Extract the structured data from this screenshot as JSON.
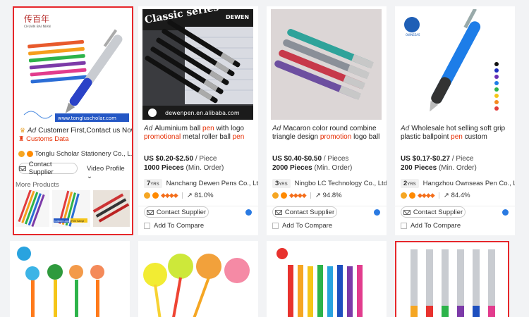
{
  "colors": {
    "accent": "#e62e04",
    "highlight": "#e6272b",
    "chat": "#2a7ae2"
  },
  "cards": [
    {
      "ad": "Ad",
      "title": "Customer First,Contact us Now!",
      "customs": "Customs Data",
      "supplier": "Tonglu Scholar Stationery Co., L...",
      "contact": "Contact Supplier",
      "video": "Video Profile",
      "more": "More Products",
      "brand": "CHUAN BAI NIAN",
      "brand_logo": "传百年",
      "url_banner": "www.tongluscholar.com",
      "thumb_text_1": "Custom Logo",
      "thumb_text_2": "Free Sampl"
    },
    {
      "ad": "Ad",
      "title_parts": [
        "Aluminium ball ",
        "pen",
        " with logo ",
        "promotional",
        " metal roller ball ",
        "pen"
      ],
      "price": "US $0.20-$2.50",
      "unit": "/ Piece",
      "moq": "1000 Pieces",
      "moq_note": "(Min. Order)",
      "years": "7",
      "yrs_label": "YRS",
      "supplier": "Nanchang Dewen Pens Co., Ltd.",
      "rate": "81.0%",
      "contact": "Contact Supplier",
      "compare": "Add To Compare",
      "banner_top": "Classic series",
      "banner_brand": "DEWEN",
      "banner_url": "dewenpen.en.alibaba.com",
      "banner_logo": "DEWEN"
    },
    {
      "ad": "Ad",
      "title_parts": [
        "Macaron color round combine triangle design ",
        "promotion",
        " logo ball ",
        "pen"
      ],
      "price": "US $0.40-$0.50",
      "unit": "/ Pieces",
      "moq": "2000 Pieces",
      "moq_note": "(Min. Order)",
      "years": "3",
      "yrs_label": "YRS",
      "supplier": "Ningbo LC Technology Co., Ltd.",
      "rate": "94.8%",
      "contact": "Contact Supplier",
      "compare": "Add To Compare"
    },
    {
      "ad": "Ad",
      "title_parts": [
        "Wholesale hot selling soft grip plastic ballpoint ",
        "pen",
        " custom company name..."
      ],
      "price": "US $0.17-$0.27",
      "unit": "/ Piece",
      "moq": "200 Pieces",
      "moq_note": "(Min. Order)",
      "years": "2",
      "yrs_label": "YRS",
      "supplier": "Hangzhou Ownseas Pen Co., Ltd.",
      "rate": "84.4%",
      "contact": "Contact Supplier",
      "compare": "Add To Compare",
      "logo_text": "OWNSEAS"
    }
  ],
  "icons": {
    "mail": "mail-icon",
    "chat": "chat-icon",
    "chevron": "chevron-right-icon",
    "badge": "gold-supplier-icon",
    "diamond": "diamond-icon",
    "share": "response-rate-icon"
  },
  "glyphs": {
    "chevron": "›",
    "diamonds": "◆◆◆◆",
    "share": "↗",
    "dropdown": "⌄"
  }
}
